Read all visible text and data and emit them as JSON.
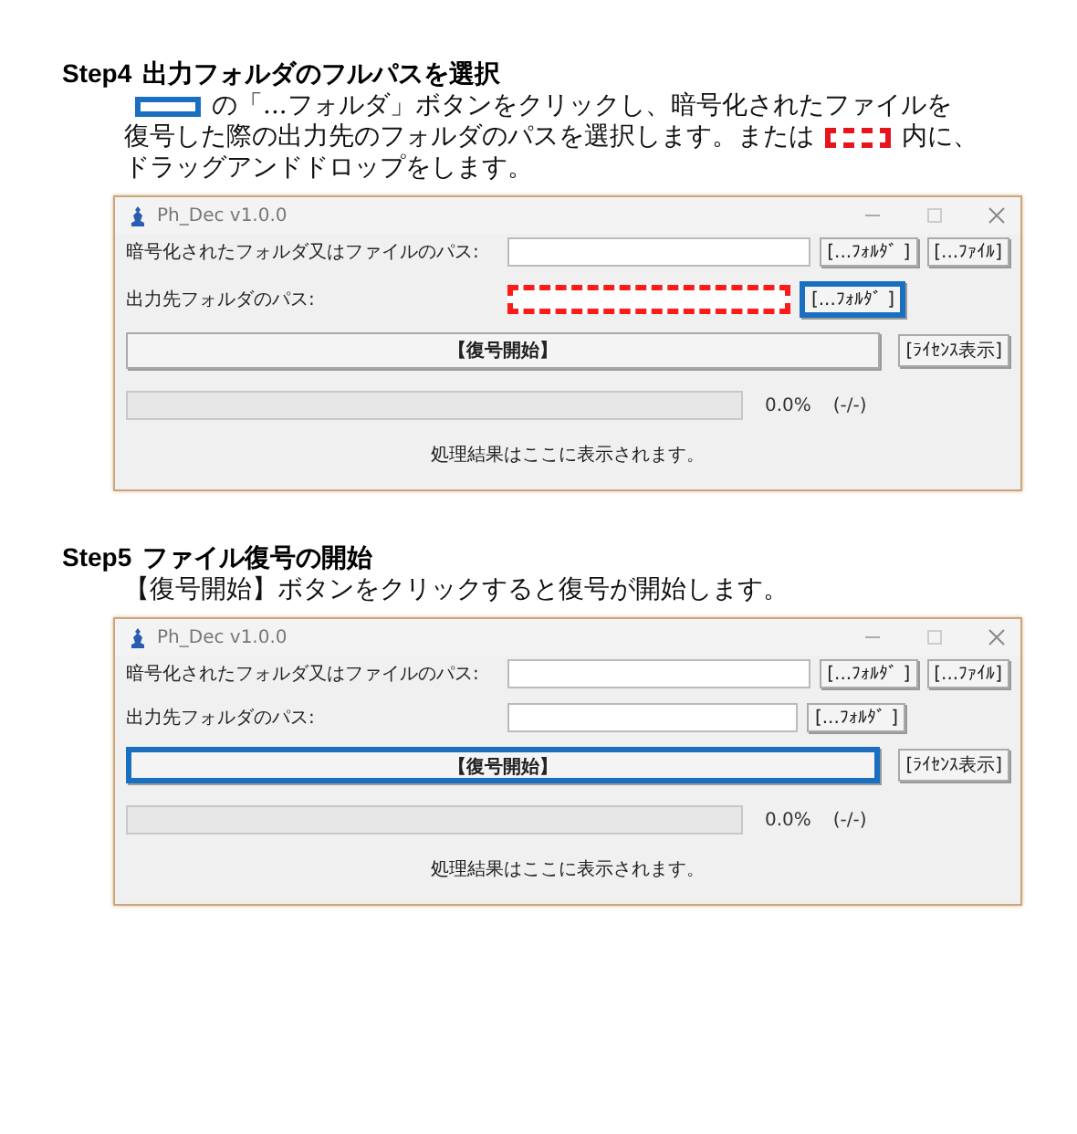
{
  "steps": [
    {
      "heading": "Step4",
      "title": "出力フォルダのフルパスを選択",
      "body": [
        [
          {
            "kind": "box"
          },
          {
            "kind": "text",
            "text": "の「...フォルダ」ボタンをクリックし、暗号化されたファイルを"
          }
        ],
        [
          {
            "kind": "text",
            "text": "復号した際の出力先のフォルダのパスを選択します。または"
          },
          {
            "kind": "dashbox"
          },
          {
            "kind": "text",
            "text": "内に、"
          }
        ],
        [
          {
            "kind": "text",
            "text": "ドラッグアンドドロップをします。"
          }
        ]
      ],
      "window": {
        "title": "Ph_Dec v1.0.0",
        "rows": [
          {
            "label": "暗号化されたフォルダ又はファイルのパス:",
            "field": {},
            "buttons": [
              {
                "label": "[...ﾌｫﾙﾀﾞ ]"
              },
              {
                "label": "[...ﾌｧｲﾙ]"
              }
            ]
          },
          {
            "label": "出力先フォルダのパス:",
            "field": {
              "highlighted": true
            },
            "buttons": [
              {
                "label": "[...ﾌｫﾙﾀﾞ ]",
                "highlighted": true
              }
            ]
          }
        ],
        "start_button": {
          "label": "【復号開始】",
          "highlighted": false
        },
        "license_button": {
          "label": "[ﾗｲｾﾝｽ表示]"
        },
        "progress": {
          "percent": "0.0%",
          "count": "(-/-)"
        },
        "result": "処理結果はここに表示されます。"
      }
    },
    {
      "heading": "Step5",
      "title": "ファイル復号の開始",
      "body": [
        [
          {
            "kind": "text",
            "text": "【復号開始】ボタンをクリックすると復号が開始します。"
          }
        ]
      ],
      "window": {
        "title": "Ph_Dec v1.0.0",
        "rows": [
          {
            "label": "暗号化されたフォルダ又はファイルのパス:",
            "field": {},
            "buttons": [
              {
                "label": "[...ﾌｫﾙﾀﾞ ]"
              },
              {
                "label": "[...ﾌｧｲﾙ]"
              }
            ]
          },
          {
            "label": "出力先フォルダのパス:",
            "field": {
              "highlighted": false
            },
            "buttons": [
              {
                "label": "[...ﾌｫﾙﾀﾞ ]",
                "highlighted": false
              }
            ]
          }
        ],
        "start_button": {
          "label": "【復号開始】",
          "highlighted": true
        },
        "license_button": {
          "label": "[ﾗｲｾﾝｽ表示]"
        },
        "progress": {
          "percent": "0.0%",
          "count": "(-/-)"
        },
        "result": "処理結果はここに表示されます。"
      }
    }
  ]
}
